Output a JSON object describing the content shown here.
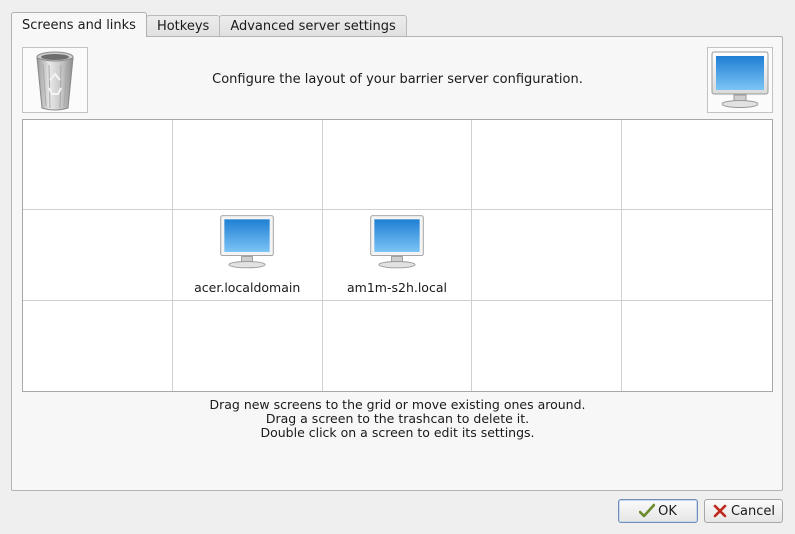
{
  "tabs": [
    {
      "label": "Screens and links",
      "active": true
    },
    {
      "label": "Hotkeys",
      "active": false
    },
    {
      "label": "Advanced server settings",
      "active": false
    }
  ],
  "header": {
    "description": "Configure the layout of your barrier server configuration.",
    "trash_icon": "trashcan-icon",
    "new_screen_icon": "monitor-icon"
  },
  "grid": {
    "columns": 5,
    "rows": 3,
    "screens": [
      {
        "name": "acer.localdomain",
        "row": 1,
        "col": 1,
        "icon": "monitor-icon"
      },
      {
        "name": "am1m-s2h.local",
        "row": 1,
        "col": 2,
        "icon": "monitor-icon"
      }
    ]
  },
  "help": {
    "line1": "Drag new screens to the grid or move existing ones around.",
    "line2": "Drag a screen to the trashcan to delete it.",
    "line3": "Double click on a screen to edit its settings."
  },
  "buttons": {
    "ok": {
      "label": "OK",
      "icon": "checkmark-icon"
    },
    "cancel": {
      "label": "Cancel",
      "icon": "x-icon"
    }
  },
  "colors": {
    "panel_bg": "#f7f7f7",
    "window_bg": "#efefef",
    "monitor_screen": "#3a9de6",
    "cancel_x": "#c0281b",
    "ok_check": "#6b8a2c"
  }
}
